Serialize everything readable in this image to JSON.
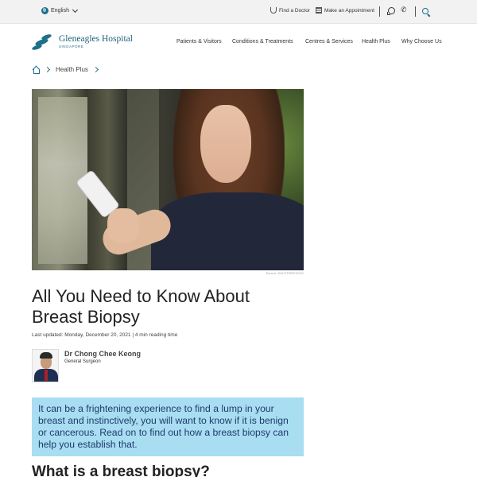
{
  "utility_bar": {
    "language": "English",
    "find_doctor": "Find a Doctor",
    "make_appointment": "Make an Appointment"
  },
  "brand": {
    "name": "Gleneagles Hospital",
    "sub": "SINGAPORE",
    "accent_color": "#1d6f8a"
  },
  "main_nav": [
    "Patients & Visitors",
    "Conditions & Treatments",
    "Centres & Services",
    "Health Plus",
    "Why Choose Us"
  ],
  "breadcrumb": {
    "current": "Health Plus"
  },
  "hero": {
    "credit": "Source: SHUTTERSTOCK"
  },
  "article": {
    "title": "All You Need to Know About Breast Biopsy",
    "meta": "Last updated: Monday, December 20, 2021  |  4 min reading time",
    "author_name": "Dr Chong Chee Keong",
    "author_role": "General Surgeon",
    "intro": "It can be a frightening experience to find a lump in your breast and instinctively, you will want to know if it is benign or cancerous. Read on to find out how a breast biopsy can help you establish that.",
    "intro_bg": "#a8ddf2",
    "subheading": "What is a breast biopsy?"
  }
}
